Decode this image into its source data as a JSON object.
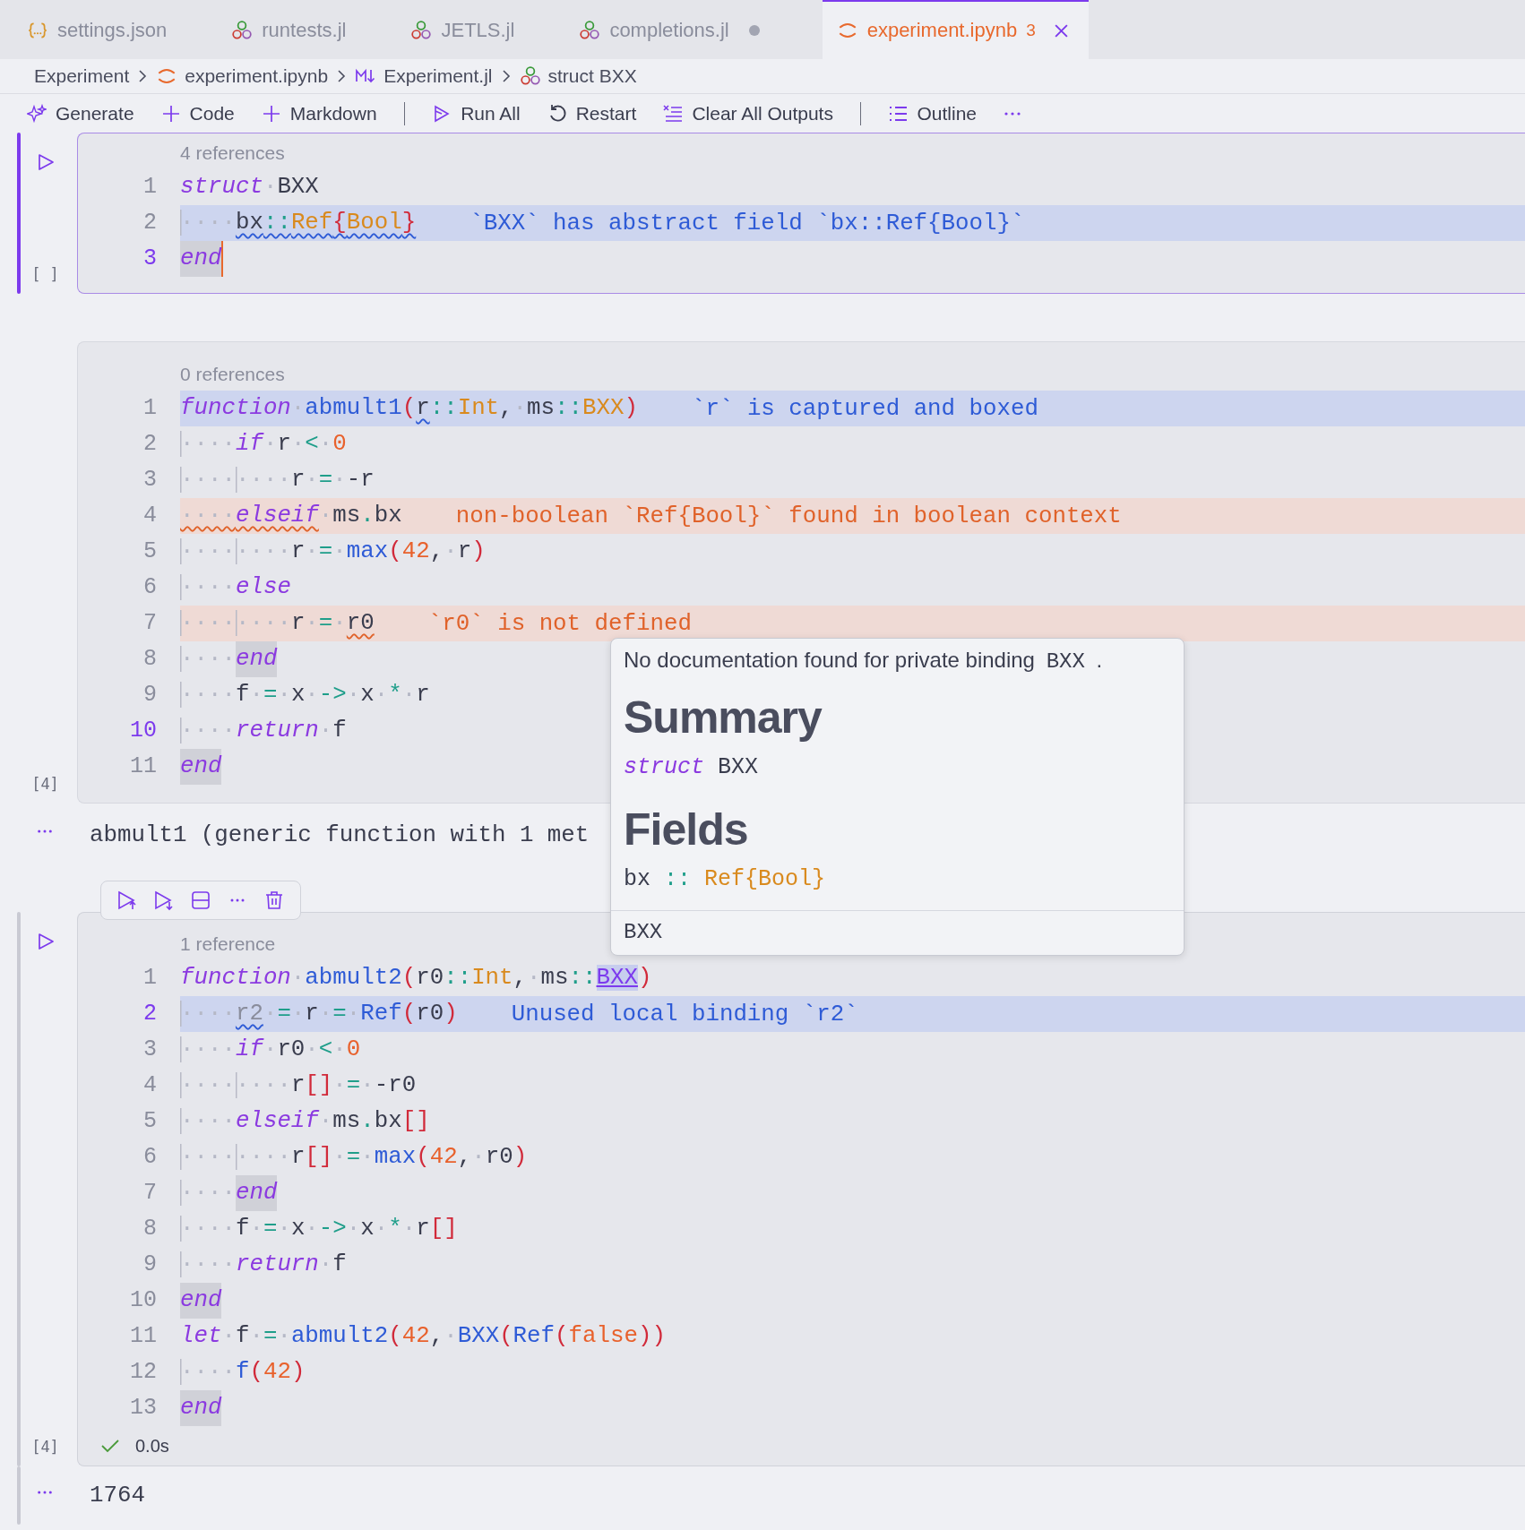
{
  "tabs": [
    {
      "label": "settings.json",
      "kind": "json",
      "selected": false,
      "dirty": false
    },
    {
      "label": "runtests.jl",
      "kind": "julia",
      "selected": false,
      "dirty": false
    },
    {
      "label": "JETLS.jl",
      "kind": "julia",
      "selected": false,
      "dirty": false
    },
    {
      "label": "completions.jl",
      "kind": "julia",
      "selected": false,
      "dirty": true
    },
    {
      "label": "experiment.ipynb",
      "kind": "notebook",
      "selected": true,
      "dirty": false,
      "problems": "3"
    }
  ],
  "breadcrumb": [
    {
      "label": "Experiment",
      "kind": "text"
    },
    {
      "label": "experiment.ipynb",
      "kind": "notebook"
    },
    {
      "label": "Experiment.jl",
      "kind": "markdown"
    },
    {
      "label": "struct BXX",
      "kind": "julia"
    }
  ],
  "toolbar": [
    {
      "kind": "sparkle",
      "label": "Generate"
    },
    {
      "kind": "plus",
      "label": "Code"
    },
    {
      "kind": "plus",
      "label": "Markdown"
    },
    {
      "kind": "separator"
    },
    {
      "kind": "runall",
      "label": "Run All"
    },
    {
      "kind": "restart",
      "label": "Restart"
    },
    {
      "kind": "clear",
      "label": "Clear All Outputs"
    },
    {
      "kind": "separator"
    },
    {
      "kind": "list",
      "label": "Outline"
    },
    {
      "kind": "more"
    }
  ],
  "cells": [
    {
      "codelens": "4 references",
      "focused": true,
      "hovered": false,
      "exec_count": "[ ]",
      "lines": [
        {
          "n": "1",
          "active": false,
          "kind": "plain",
          "tokens": [
            {
              "kind": "kw",
              "text": "struct"
            },
            {
              "kind": "ws",
              "text": "·"
            },
            {
              "kind": "id",
              "text": "BXX"
            }
          ]
        },
        {
          "n": "2",
          "active": false,
          "kind": "info",
          "message": "`BXX` has abstract field `bx::Ref{Bool}`",
          "tokens": [
            {
              "kind": "guide",
              "text": "····"
            },
            {
              "kind": "id_isq",
              "text": "bx"
            },
            {
              "kind": "op_isq",
              "text": "::"
            },
            {
              "kind": "type_isq",
              "text": "Ref"
            },
            {
              "kind": "paren_isq",
              "text": "{"
            },
            {
              "kind": "type_isq",
              "text": "Bool"
            },
            {
              "kind": "paren_isq",
              "text": "}"
            }
          ]
        },
        {
          "n": "3",
          "active": true,
          "kind": "plain",
          "tokens": [
            {
              "kind": "kw_cursor",
              "text": "end"
            }
          ]
        }
      ]
    },
    {
      "codelens": "0 references",
      "focused": false,
      "hovered": false,
      "exec_count": "[4]",
      "output": "abmult1 (generic function with 1 met",
      "lines": [
        {
          "n": "1",
          "active": false,
          "kind": "info",
          "message": "`r` is captured and boxed",
          "tokens": [
            {
              "kind": "kw",
              "text": "function"
            },
            {
              "kind": "ws",
              "text": "·"
            },
            {
              "kind": "fn",
              "text": "abmult1"
            },
            {
              "kind": "paren",
              "text": "("
            },
            {
              "kind": "id_isq",
              "text": "r"
            },
            {
              "kind": "op",
              "text": "::"
            },
            {
              "kind": "type",
              "text": "Int"
            },
            {
              "kind": "punct",
              "text": ","
            },
            {
              "kind": "ws",
              "text": "·"
            },
            {
              "kind": "id",
              "text": "ms"
            },
            {
              "kind": "op",
              "text": "::"
            },
            {
              "kind": "type",
              "text": "BXX"
            },
            {
              "kind": "paren",
              "text": ")"
            }
          ]
        },
        {
          "n": "2",
          "active": false,
          "kind": "plain",
          "tokens": [
            {
              "kind": "guide",
              "text": "····"
            },
            {
              "kind": "kw",
              "text": "if"
            },
            {
              "kind": "ws",
              "text": "·"
            },
            {
              "kind": "id",
              "text": "r"
            },
            {
              "kind": "ws",
              "text": "·"
            },
            {
              "kind": "op",
              "text": "<"
            },
            {
              "kind": "ws",
              "text": "·"
            },
            {
              "kind": "num",
              "text": "0"
            }
          ]
        },
        {
          "n": "3",
          "active": false,
          "kind": "plain",
          "tokens": [
            {
              "kind": "guide",
              "text": "····"
            },
            {
              "kind": "guide",
              "text": "····"
            },
            {
              "kind": "id",
              "text": "r"
            },
            {
              "kind": "ws",
              "text": "·"
            },
            {
              "kind": "op",
              "text": "="
            },
            {
              "kind": "ws",
              "text": "·"
            },
            {
              "kind": "id",
              "text": "-r"
            }
          ]
        },
        {
          "n": "4",
          "active": false,
          "kind": "error",
          "message": "non-boolean `Ref{Bool}` found in boolean context",
          "tokens": [
            {
              "kind": "ws_esq",
              "text": "····"
            },
            {
              "kind": "kw_esq",
              "text": "elseif"
            },
            {
              "kind": "ws",
              "text": "·"
            },
            {
              "kind": "id",
              "text": "ms"
            },
            {
              "kind": "op",
              "text": "."
            },
            {
              "kind": "id",
              "text": "bx"
            }
          ]
        },
        {
          "n": "5",
          "active": false,
          "kind": "plain",
          "tokens": [
            {
              "kind": "guide",
              "text": "····"
            },
            {
              "kind": "guide",
              "text": "····"
            },
            {
              "kind": "id",
              "text": "r"
            },
            {
              "kind": "ws",
              "text": "·"
            },
            {
              "kind": "op",
              "text": "="
            },
            {
              "kind": "ws",
              "text": "·"
            },
            {
              "kind": "fn",
              "text": "max"
            },
            {
              "kind": "paren",
              "text": "("
            },
            {
              "kind": "num",
              "text": "42"
            },
            {
              "kind": "punct",
              "text": ","
            },
            {
              "kind": "ws",
              "text": "·"
            },
            {
              "kind": "id",
              "text": "r"
            },
            {
              "kind": "paren",
              "text": ")"
            }
          ]
        },
        {
          "n": "6",
          "active": false,
          "kind": "plain",
          "tokens": [
            {
              "kind": "guide",
              "text": "····"
            },
            {
              "kind": "kw",
              "text": "else"
            }
          ]
        },
        {
          "n": "7",
          "active": false,
          "kind": "error",
          "message": "`r0` is not defined",
          "tokens": [
            {
              "kind": "guide",
              "text": "····"
            },
            {
              "kind": "guide",
              "text": "····"
            },
            {
              "kind": "id",
              "text": "r"
            },
            {
              "kind": "ws",
              "text": "·"
            },
            {
              "kind": "op",
              "text": "="
            },
            {
              "kind": "ws",
              "text": "·"
            },
            {
              "kind": "id_esq",
              "text": "r0"
            }
          ]
        },
        {
          "n": "8",
          "active": false,
          "kind": "plain",
          "tokens": [
            {
              "kind": "guide",
              "text": "····"
            },
            {
              "kind": "kw_match",
              "text": "end"
            }
          ]
        },
        {
          "n": "9",
          "active": false,
          "kind": "plain",
          "tokens": [
            {
              "kind": "guide",
              "text": "····"
            },
            {
              "kind": "id",
              "text": "f"
            },
            {
              "kind": "ws",
              "text": "·"
            },
            {
              "kind": "op",
              "text": "="
            },
            {
              "kind": "ws",
              "text": "·"
            },
            {
              "kind": "id",
              "text": "x"
            },
            {
              "kind": "ws",
              "text": "·"
            },
            {
              "kind": "op",
              "text": "->"
            },
            {
              "kind": "ws",
              "text": "·"
            },
            {
              "kind": "id",
              "text": "x"
            },
            {
              "kind": "ws",
              "text": "·"
            },
            {
              "kind": "op",
              "text": "*"
            },
            {
              "kind": "ws",
              "text": "·"
            },
            {
              "kind": "id",
              "text": "r"
            }
          ]
        },
        {
          "n": "10",
          "active": true,
          "kind": "plain",
          "tokens": [
            {
              "kind": "guide",
              "text": "····"
            },
            {
              "kind": "kw",
              "text": "return"
            },
            {
              "kind": "ws",
              "text": "·"
            },
            {
              "kind": "id",
              "text": "f"
            }
          ]
        },
        {
          "n": "11",
          "active": false,
          "kind": "plain",
          "tokens": [
            {
              "kind": "kw_match",
              "text": "end"
            }
          ]
        }
      ]
    },
    {
      "codelens": "1 reference",
      "focused": false,
      "hovered": true,
      "exec_count": "[4]",
      "status": {
        "ok": true,
        "time": "0.0s"
      },
      "output": "1764",
      "lines": [
        {
          "n": "1",
          "active": false,
          "kind": "plain",
          "tokens": [
            {
              "kind": "kw",
              "text": "function"
            },
            {
              "kind": "ws",
              "text": "·"
            },
            {
              "kind": "fn",
              "text": "abmult2"
            },
            {
              "kind": "paren",
              "text": "("
            },
            {
              "kind": "id",
              "text": "r0"
            },
            {
              "kind": "op",
              "text": "::"
            },
            {
              "kind": "type",
              "text": "Int"
            },
            {
              "kind": "punct",
              "text": ","
            },
            {
              "kind": "ws",
              "text": "·"
            },
            {
              "kind": "id",
              "text": "ms"
            },
            {
              "kind": "op",
              "text": "::"
            },
            {
              "kind": "fn_link",
              "text": "BXX"
            },
            {
              "kind": "paren",
              "text": ")"
            }
          ]
        },
        {
          "n": "2",
          "active": true,
          "kind": "info",
          "message": "Unused local binding `r2`",
          "tokens": [
            {
              "kind": "guide",
              "text": "····"
            },
            {
              "kind": "unused_isq",
              "text": "r2"
            },
            {
              "kind": "ws",
              "text": "·"
            },
            {
              "kind": "op",
              "text": "="
            },
            {
              "kind": "ws",
              "text": "·"
            },
            {
              "kind": "id",
              "text": "r"
            },
            {
              "kind": "ws",
              "text": "·"
            },
            {
              "kind": "op",
              "text": "="
            },
            {
              "kind": "ws",
              "text": "·"
            },
            {
              "kind": "fn",
              "text": "Ref"
            },
            {
              "kind": "paren",
              "text": "("
            },
            {
              "kind": "id",
              "text": "r0"
            },
            {
              "kind": "paren",
              "text": ")"
            }
          ]
        },
        {
          "n": "3",
          "active": false,
          "kind": "plain",
          "tokens": [
            {
              "kind": "guide",
              "text": "····"
            },
            {
              "kind": "kw",
              "text": "if"
            },
            {
              "kind": "ws",
              "text": "·"
            },
            {
              "kind": "id",
              "text": "r0"
            },
            {
              "kind": "ws",
              "text": "·"
            },
            {
              "kind": "op",
              "text": "<"
            },
            {
              "kind": "ws",
              "text": "·"
            },
            {
              "kind": "num",
              "text": "0"
            }
          ]
        },
        {
          "n": "4",
          "active": false,
          "kind": "plain",
          "tokens": [
            {
              "kind": "guide",
              "text": "····"
            },
            {
              "kind": "guide",
              "text": "····"
            },
            {
              "kind": "id",
              "text": "r"
            },
            {
              "kind": "paren",
              "text": "[]"
            },
            {
              "kind": "ws",
              "text": "·"
            },
            {
              "kind": "op",
              "text": "="
            },
            {
              "kind": "ws",
              "text": "·"
            },
            {
              "kind": "id",
              "text": "-r0"
            }
          ]
        },
        {
          "n": "5",
          "active": false,
          "kind": "plain",
          "tokens": [
            {
              "kind": "guide",
              "text": "····"
            },
            {
              "kind": "kw",
              "text": "elseif"
            },
            {
              "kind": "ws",
              "text": "·"
            },
            {
              "kind": "id",
              "text": "ms"
            },
            {
              "kind": "op",
              "text": "."
            },
            {
              "kind": "id",
              "text": "bx"
            },
            {
              "kind": "paren",
              "text": "[]"
            }
          ]
        },
        {
          "n": "6",
          "active": false,
          "kind": "plain",
          "tokens": [
            {
              "kind": "guide",
              "text": "····"
            },
            {
              "kind": "guide",
              "text": "····"
            },
            {
              "kind": "id",
              "text": "r"
            },
            {
              "kind": "paren",
              "text": "[]"
            },
            {
              "kind": "ws",
              "text": "·"
            },
            {
              "kind": "op",
              "text": "="
            },
            {
              "kind": "ws",
              "text": "·"
            },
            {
              "kind": "fn",
              "text": "max"
            },
            {
              "kind": "paren",
              "text": "("
            },
            {
              "kind": "num",
              "text": "42"
            },
            {
              "kind": "punct",
              "text": ","
            },
            {
              "kind": "ws",
              "text": "·"
            },
            {
              "kind": "id",
              "text": "r0"
            },
            {
              "kind": "paren",
              "text": ")"
            }
          ]
        },
        {
          "n": "7",
          "active": false,
          "kind": "plain",
          "tokens": [
            {
              "kind": "guide",
              "text": "····"
            },
            {
              "kind": "kw_match",
              "text": "end"
            }
          ]
        },
        {
          "n": "8",
          "active": false,
          "kind": "plain",
          "tokens": [
            {
              "kind": "guide",
              "text": "····"
            },
            {
              "kind": "id",
              "text": "f"
            },
            {
              "kind": "ws",
              "text": "·"
            },
            {
              "kind": "op",
              "text": "="
            },
            {
              "kind": "ws",
              "text": "·"
            },
            {
              "kind": "id",
              "text": "x"
            },
            {
              "kind": "ws",
              "text": "·"
            },
            {
              "kind": "op",
              "text": "->"
            },
            {
              "kind": "ws",
              "text": "·"
            },
            {
              "kind": "id",
              "text": "x"
            },
            {
              "kind": "ws",
              "text": "·"
            },
            {
              "kind": "op",
              "text": "*"
            },
            {
              "kind": "ws",
              "text": "·"
            },
            {
              "kind": "id",
              "text": "r"
            },
            {
              "kind": "paren",
              "text": "[]"
            }
          ]
        },
        {
          "n": "9",
          "active": false,
          "kind": "plain",
          "tokens": [
            {
              "kind": "guide",
              "text": "····"
            },
            {
              "kind": "kw",
              "text": "return"
            },
            {
              "kind": "ws",
              "text": "·"
            },
            {
              "kind": "id",
              "text": "f"
            }
          ]
        },
        {
          "n": "10",
          "active": false,
          "kind": "plain",
          "tokens": [
            {
              "kind": "kw_match",
              "text": "end"
            }
          ]
        },
        {
          "n": "11",
          "active": false,
          "kind": "plain",
          "tokens": [
            {
              "kind": "kw",
              "text": "let"
            },
            {
              "kind": "ws",
              "text": "·"
            },
            {
              "kind": "id",
              "text": "f"
            },
            {
              "kind": "ws",
              "text": "·"
            },
            {
              "kind": "op",
              "text": "="
            },
            {
              "kind": "ws",
              "text": "·"
            },
            {
              "kind": "fn",
              "text": "abmult2"
            },
            {
              "kind": "paren",
              "text": "("
            },
            {
              "kind": "num",
              "text": "42"
            },
            {
              "kind": "punct",
              "text": ","
            },
            {
              "kind": "ws",
              "text": "·"
            },
            {
              "kind": "fn",
              "text": "BXX"
            },
            {
              "kind": "paren",
              "text": "("
            },
            {
              "kind": "fn",
              "text": "Ref"
            },
            {
              "kind": "paren",
              "text": "("
            },
            {
              "kind": "num",
              "text": "false"
            },
            {
              "kind": "paren",
              "text": "))"
            }
          ]
        },
        {
          "n": "12",
          "active": false,
          "kind": "plain",
          "tokens": [
            {
              "kind": "guide",
              "text": "····"
            },
            {
              "kind": "fn",
              "text": "f"
            },
            {
              "kind": "paren",
              "text": "("
            },
            {
              "kind": "num",
              "text": "42"
            },
            {
              "kind": "paren",
              "text": ")"
            }
          ]
        },
        {
          "n": "13",
          "active": false,
          "kind": "plain",
          "tokens": [
            {
              "kind": "kw_match",
              "text": "end"
            }
          ]
        }
      ]
    }
  ],
  "hover": {
    "intro": "No documentation found for private binding",
    "intro_code": "BXX",
    "intro_end": ".",
    "sections": [
      {
        "heading": "Summary",
        "code": [
          {
            "kind": "kw",
            "text": "struct"
          },
          {
            "kind": "id",
            "text": "BXX"
          }
        ]
      },
      {
        "heading": "Fields",
        "code": [
          {
            "kind": "id",
            "text": "bx"
          },
          {
            "kind": "op",
            "text": "::"
          },
          {
            "kind": "type",
            "text": "Ref{Bool}"
          }
        ]
      }
    ],
    "footer": "BXX"
  }
}
